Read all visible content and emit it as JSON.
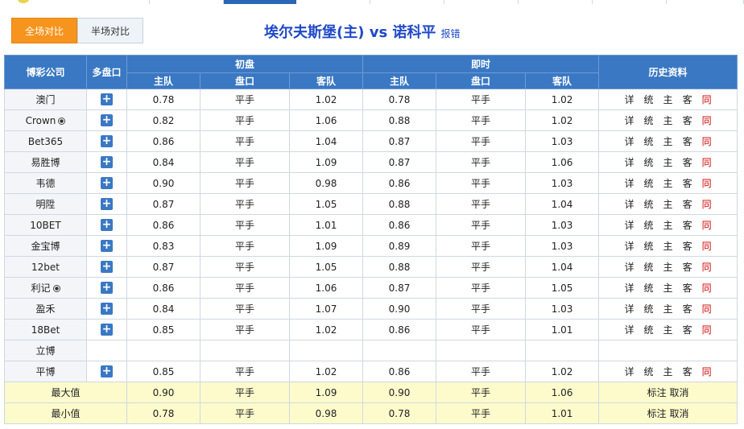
{
  "tabs": {
    "full": "全场对比",
    "half": "半场对比"
  },
  "title": {
    "main": "埃尔夫斯堡(主) vs 诺科平",
    "report": "报错"
  },
  "headers": {
    "company": "博彩公司",
    "multi": "多盘口",
    "initial": "初盘",
    "live": "即时",
    "history": "历史资料",
    "home": "主队",
    "line": "盘口",
    "away": "客队"
  },
  "icons": {
    "expand": "plus-icon",
    "ball": "soccer-ball-icon"
  },
  "link_labels": [
    "详",
    "统",
    "主",
    "客",
    "同"
  ],
  "rows": [
    {
      "company": "澳门",
      "ball": false,
      "init": [
        "0.78",
        "平手",
        "1.02"
      ],
      "live": [
        "0.78",
        "平手",
        "1.02"
      ]
    },
    {
      "company": "Crown",
      "ball": true,
      "init": [
        "0.82",
        "平手",
        "1.06"
      ],
      "live": [
        "0.88",
        "平手",
        "1.02"
      ]
    },
    {
      "company": "Bet365",
      "ball": false,
      "init": [
        "0.86",
        "平手",
        "1.04"
      ],
      "live": [
        "0.87",
        "平手",
        "1.03"
      ]
    },
    {
      "company": "易胜博",
      "ball": false,
      "init": [
        "0.84",
        "平手",
        "1.09"
      ],
      "live": [
        "0.87",
        "平手",
        "1.06"
      ]
    },
    {
      "company": "韦德",
      "ball": false,
      "init": [
        "0.90",
        "平手",
        "0.98"
      ],
      "live": [
        "0.86",
        "平手",
        "1.03"
      ]
    },
    {
      "company": "明陞",
      "ball": false,
      "init": [
        "0.87",
        "平手",
        "1.05"
      ],
      "live": [
        "0.88",
        "平手",
        "1.04"
      ]
    },
    {
      "company": "10BET",
      "ball": false,
      "init": [
        "0.86",
        "平手",
        "1.01"
      ],
      "live": [
        "0.86",
        "平手",
        "1.03"
      ]
    },
    {
      "company": "金宝博",
      "ball": false,
      "init": [
        "0.83",
        "平手",
        "1.09"
      ],
      "live": [
        "0.89",
        "平手",
        "1.03"
      ]
    },
    {
      "company": "12bet",
      "ball": false,
      "init": [
        "0.87",
        "平手",
        "1.05"
      ],
      "live": [
        "0.88",
        "平手",
        "1.04"
      ]
    },
    {
      "company": "利记",
      "ball": true,
      "init": [
        "0.86",
        "平手",
        "1.06"
      ],
      "live": [
        "0.87",
        "平手",
        "1.05"
      ]
    },
    {
      "company": "盈禾",
      "ball": false,
      "init": [
        "0.84",
        "平手",
        "1.07"
      ],
      "live": [
        "0.90",
        "平手",
        "1.03"
      ]
    },
    {
      "company": "18Bet",
      "ball": false,
      "init": [
        "0.85",
        "平手",
        "1.02"
      ],
      "live": [
        "0.86",
        "平手",
        "1.01"
      ]
    },
    {
      "company": "立博",
      "ball": false,
      "empty": true,
      "init": [
        "",
        "",
        ""
      ],
      "live": [
        "",
        "",
        ""
      ]
    },
    {
      "company": "平博",
      "ball": false,
      "init": [
        "0.85",
        "平手",
        "1.02"
      ],
      "live": [
        "0.86",
        "平手",
        "1.02"
      ]
    }
  ],
  "summary": [
    {
      "label": "最大值",
      "init": [
        "0.90",
        "平手",
        "1.09"
      ],
      "live": [
        "0.90",
        "平手",
        "1.06"
      ],
      "links": [
        "标注",
        "取消"
      ]
    },
    {
      "label": "最小值",
      "init": [
        "0.78",
        "平手",
        "0.98"
      ],
      "live": [
        "0.78",
        "平手",
        "1.01"
      ],
      "links": [
        "标注",
        "取消"
      ]
    }
  ]
}
